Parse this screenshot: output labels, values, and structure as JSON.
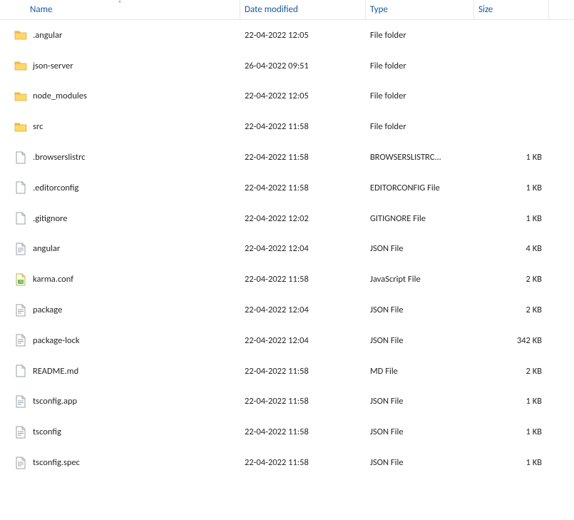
{
  "columns": {
    "name": "Name",
    "date": "Date modified",
    "type": "Type",
    "size": "Size"
  },
  "sort_indicator": "˄",
  "rows": [
    {
      "icon": "folder",
      "name": ".angular",
      "date": "22-04-2022 12:05",
      "type": "File folder",
      "size": ""
    },
    {
      "icon": "folder",
      "name": "json-server",
      "date": "26-04-2022 09:51",
      "type": "File folder",
      "size": ""
    },
    {
      "icon": "folder",
      "name": "node_modules",
      "date": "22-04-2022 12:05",
      "type": "File folder",
      "size": ""
    },
    {
      "icon": "folder",
      "name": "src",
      "date": "22-04-2022 11:58",
      "type": "File folder",
      "size": ""
    },
    {
      "icon": "blank",
      "name": ".browserslistrc",
      "date": "22-04-2022 11:58",
      "type": "BROWSERSLISTRC...",
      "size": "1 KB"
    },
    {
      "icon": "blank",
      "name": ".editorconfig",
      "date": "22-04-2022 11:58",
      "type": "EDITORCONFIG File",
      "size": "1 KB"
    },
    {
      "icon": "blank",
      "name": ".gitignore",
      "date": "22-04-2022 12:02",
      "type": "GITIGNORE File",
      "size": "1 KB"
    },
    {
      "icon": "lines",
      "name": "angular",
      "date": "22-04-2022 12:04",
      "type": "JSON File",
      "size": "4 KB"
    },
    {
      "icon": "js",
      "name": "karma.conf",
      "date": "22-04-2022 11:58",
      "type": "JavaScript File",
      "size": "2 KB"
    },
    {
      "icon": "lines",
      "name": "package",
      "date": "22-04-2022 12:04",
      "type": "JSON File",
      "size": "2 KB"
    },
    {
      "icon": "lines",
      "name": "package-lock",
      "date": "22-04-2022 12:04",
      "type": "JSON File",
      "size": "342 KB"
    },
    {
      "icon": "blank",
      "name": "README.md",
      "date": "22-04-2022 11:58",
      "type": "MD File",
      "size": "2 KB"
    },
    {
      "icon": "lines",
      "name": "tsconfig.app",
      "date": "22-04-2022 11:58",
      "type": "JSON File",
      "size": "1 KB"
    },
    {
      "icon": "lines",
      "name": "tsconfig",
      "date": "22-04-2022 11:58",
      "type": "JSON File",
      "size": "1 KB"
    },
    {
      "icon": "lines",
      "name": "tsconfig.spec",
      "date": "22-04-2022 11:58",
      "type": "JSON File",
      "size": "1 KB"
    }
  ]
}
